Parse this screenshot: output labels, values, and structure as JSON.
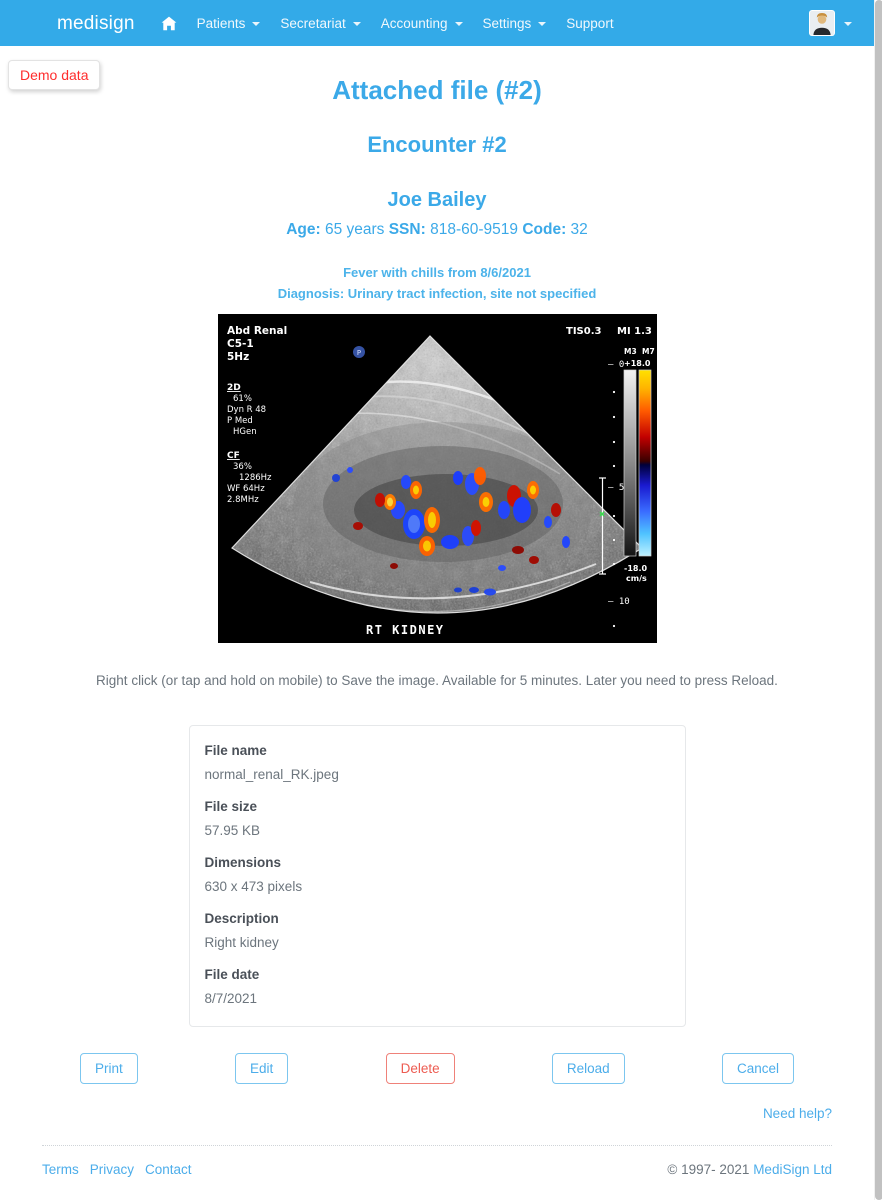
{
  "navbar": {
    "brand": "medisign",
    "items": [
      {
        "label": "",
        "icon": "home-icon",
        "caret": false
      },
      {
        "label": "Patients",
        "icon": "",
        "caret": true
      },
      {
        "label": "Secretariat",
        "icon": "",
        "caret": true
      },
      {
        "label": "Accounting",
        "icon": "",
        "caret": true
      },
      {
        "label": "Settings",
        "icon": "",
        "caret": true
      },
      {
        "label": "Support",
        "icon": "",
        "caret": false
      }
    ],
    "avatar_icon": "user-avatar-icon",
    "avatar_caret": true,
    "bg_color": "#33aae8"
  },
  "demo_badge": {
    "label": "Demo data",
    "text_color": "#ff2d2d"
  },
  "header": {
    "title": "Attached file (#2)",
    "encounter": "Encounter #2",
    "patient_name": "Joe Bailey",
    "age_label": "Age:",
    "age_value": "65 years",
    "ssn_label": "SSN:",
    "ssn_value": "818-60-9519",
    "code_label": "Code:",
    "code_value": "32",
    "reason": "Fever with chills from 8/6/2021",
    "diagnosis": "Diagnosis: Urinary tract infection, site not specified",
    "accent_color": "#3ba9e8"
  },
  "image": {
    "alt": "renal-ultrasound-image",
    "overlay": {
      "exam": "Abd Renal",
      "probe": "C5-1",
      "freq": "5Hz",
      "mode_2d_label": "2D",
      "mode_2d_gain": "61%",
      "mode_2d_dyn": "Dyn R 48",
      "mode_2d_p": "P Med",
      "mode_2d_hgen": "HGen",
      "cf_label": "CF",
      "cf_gain": "36%",
      "cf_prf": "1286Hz",
      "cf_wf": "WF 64Hz",
      "cf_freq": "2.8MHz",
      "tis": "TIS0.3",
      "mi": "MI 1.3",
      "map_m3": "M3",
      "map_m7": "M7",
      "scale_max": "+18.0",
      "scale_min": "-18.0",
      "scale_unit": "cm/s",
      "depth_0": "0",
      "depth_5": "5",
      "depth_10": "10",
      "label_bottom": "RT KIDNEY"
    }
  },
  "note": "Right click (or tap and hold on mobile) to Save the image. Available for 5 minutes. Later you need to press Reload.",
  "details": [
    {
      "label": "File name",
      "value": "normal_renal_RK.jpeg"
    },
    {
      "label": "File size",
      "value": "57.95 KB"
    },
    {
      "label": "Dimensions",
      "value": "630 x 473 pixels"
    },
    {
      "label": "Description",
      "value": "Right kidney"
    },
    {
      "label": "File date",
      "value": "8/7/2021"
    }
  ],
  "actions": [
    {
      "label": "Print",
      "style": "primary"
    },
    {
      "label": "Edit",
      "style": "primary"
    },
    {
      "label": "Delete",
      "style": "danger"
    },
    {
      "label": "Reload",
      "style": "primary"
    },
    {
      "label": "Cancel",
      "style": "primary"
    }
  ],
  "help": {
    "label": "Need help?"
  },
  "footer": {
    "links": [
      "Terms",
      "Privacy",
      "Contact"
    ],
    "copyright_prefix": "© 1997- 2021 ",
    "company": "MediSign Ltd"
  }
}
